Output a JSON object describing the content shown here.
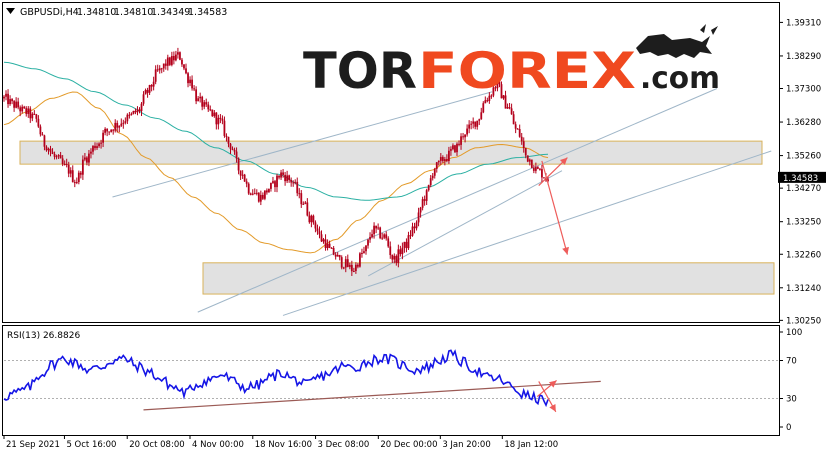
{
  "header": {
    "symbol_label": "GBPUSDi,H4",
    "ohlc_values": [
      "1.34810",
      "1.34810",
      "1.34349",
      "1.34583"
    ]
  },
  "brand": {
    "logo_left": "TOR",
    "logo_right": "FOREX",
    "logo_suffix": ".com",
    "logo_icon": "bull-icon"
  },
  "colors": {
    "candle": "#b3001b",
    "ma_fast": "#e39b2a",
    "ma_slow": "#2bb0a3",
    "trendline": "#9fb6c8",
    "zone_border": "#d8b25a",
    "arrow": "#ee5c5a",
    "rsi_line": "#1515e6",
    "rsi_trendline": "#9b5a55",
    "logo_dark": "#1d1d1d",
    "logo_accent": "#f0491f"
  },
  "chart_data": [
    {
      "type": "candlestick",
      "title": "GBPUSDi,H4",
      "ylim": [
        1.302,
        1.399
      ],
      "y_ticks": [
        "1.39310",
        "1.38290",
        "1.37300",
        "1.36280",
        "1.35260",
        "1.34270",
        "1.33250",
        "1.32260",
        "1.31240",
        "1.30250"
      ],
      "current_price_label": "1.34583",
      "x_ticks": [
        "21 Sep 2021",
        "5 Oct 16:00",
        "20 Oct 08:00",
        "4 Nov 00:00",
        "18 Nov 16:00",
        "3 Dec 08:00",
        "20 Dec 00:00",
        "3 Jan 20:00",
        "18 Jan 12:00"
      ],
      "close_path_anchors": [
        1.37,
        1.368,
        1.366,
        1.364,
        1.356,
        1.352,
        1.349,
        1.345,
        1.352,
        1.356,
        1.36,
        1.362,
        1.364,
        1.366,
        1.372,
        1.378,
        1.381,
        1.383,
        1.376,
        1.369,
        1.366,
        1.363,
        1.356,
        1.348,
        1.342,
        1.34,
        1.343,
        1.347,
        1.345,
        1.339,
        1.333,
        1.327,
        1.323,
        1.32,
        1.318,
        1.323,
        1.33,
        1.328,
        1.321,
        1.325,
        1.331,
        1.34,
        1.349,
        1.352,
        1.355,
        1.36,
        1.363,
        1.37,
        1.374,
        1.368,
        1.36,
        1.352,
        1.348,
        1.3458
      ],
      "series": [
        {
          "name": "",
          "role": "moving-average-fast",
          "values": [
            1.362,
            1.366,
            1.37,
            1.372,
            1.367,
            1.359,
            1.352,
            1.346,
            1.34,
            1.335,
            1.33,
            1.326,
            1.324,
            1.323,
            1.327,
            1.333,
            1.339,
            1.344,
            1.348,
            1.352,
            1.355,
            1.356,
            1.355,
            1.352
          ]
        },
        {
          "name": "",
          "role": "moving-average-slow",
          "values": [
            1.381,
            1.379,
            1.376,
            1.372,
            1.368,
            1.364,
            1.36,
            1.355,
            1.351,
            1.347,
            1.343,
            1.34,
            1.339,
            1.34,
            1.343,
            1.347,
            1.35,
            1.352,
            1.353
          ]
        }
      ],
      "zones": [
        {
          "from": 1.35,
          "to": 1.357
        },
        {
          "from": 1.3105,
          "to": 1.32
        }
      ],
      "trendlines": [
        {
          "from": [
            0.14,
            1.34
          ],
          "to": [
            0.63,
            1.372
          ]
        },
        {
          "from": [
            0.25,
            1.305
          ],
          "to": [
            0.92,
            1.373
          ]
        },
        {
          "from": [
            0.36,
            1.304
          ],
          "to": [
            0.99,
            1.354
          ]
        },
        {
          "from": [
            0.47,
            1.316
          ],
          "to": [
            0.72,
            1.348
          ]
        }
      ],
      "arrows": [
        {
          "from": [
            0.69,
            1.3435
          ],
          "to": [
            0.727,
            1.352
          ]
        },
        {
          "from": [
            0.694,
            1.351
          ],
          "to": [
            0.727,
            1.3225
          ]
        }
      ]
    },
    {
      "type": "line",
      "title": "RSI(13) 26.8826",
      "ylim": [
        0,
        100
      ],
      "y_ticks": [
        "100",
        "70",
        "30",
        "0"
      ],
      "levels": [
        70,
        30
      ],
      "anchors": [
        32,
        36,
        41,
        55,
        66,
        72,
        67,
        60,
        63,
        70,
        72,
        64,
        58,
        50,
        42,
        36,
        45,
        50,
        55,
        48,
        41,
        44,
        52,
        57,
        50,
        44,
        52,
        57,
        64,
        62,
        68,
        72,
        71,
        65,
        60,
        63,
        70,
        76,
        68,
        60,
        52,
        50,
        42,
        34,
        30,
        27
      ],
      "trendline": {
        "from": [
          0.18,
          18
        ],
        "to": [
          0.77,
          48
        ]
      },
      "arrows": [
        {
          "from": [
            0.688,
            32
          ],
          "to": [
            0.713,
            49
          ]
        },
        {
          "from": [
            0.69,
            48
          ],
          "to": [
            0.712,
            16
          ]
        }
      ]
    }
  ]
}
